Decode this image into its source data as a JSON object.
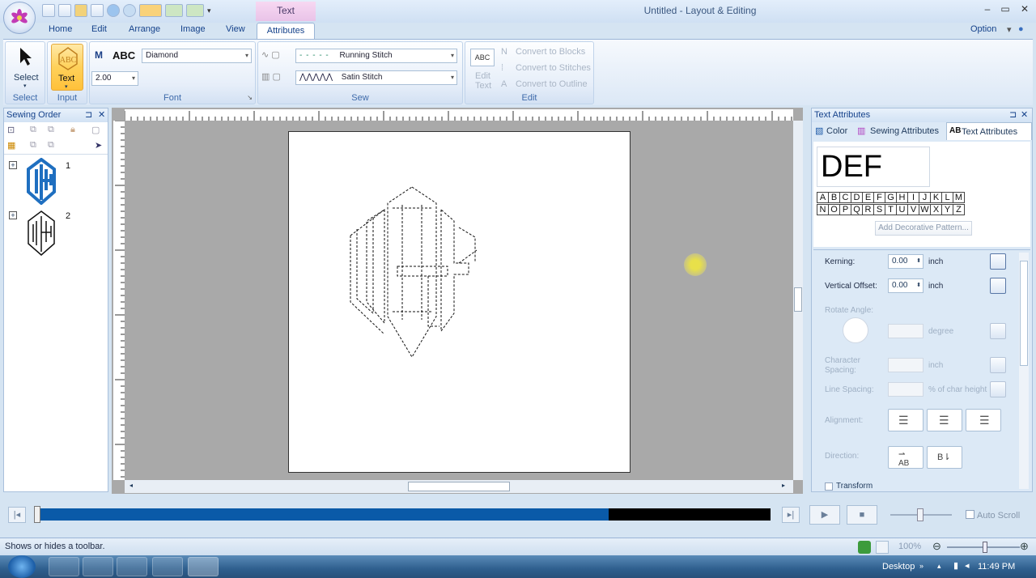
{
  "window": {
    "title": "Untitled - Layout & Editing",
    "context_tab": "Text",
    "option_label": "Option"
  },
  "tabs": [
    "Home",
    "Edit",
    "Arrange",
    "Image",
    "View",
    "Attributes"
  ],
  "ribbon": {
    "select": {
      "button": "Select",
      "group": "Select"
    },
    "input": {
      "button": "Text",
      "group": "Input"
    },
    "font": {
      "sample": "ABC",
      "font_name": "Diamond",
      "size": "2.00",
      "group": "Font"
    },
    "sew": {
      "running": "Running Stitch",
      "satin": "Satin Stitch",
      "group": "Sew"
    },
    "edit": {
      "edit_text_icon": "ABC",
      "edit_text": "Edit",
      "edit_text2": "Text",
      "to_blocks": "Convert to Blocks",
      "to_stitches": "Convert to Stitches",
      "to_outline": "Convert to Outline",
      "group": "Edit"
    }
  },
  "sewing_order": {
    "title": "Sewing Order",
    "items": [
      {
        "num": "1"
      },
      {
        "num": "2"
      }
    ]
  },
  "text_attributes": {
    "title": "Text Attributes",
    "tabs": [
      "Color",
      "Sewing Attributes",
      "Text Attributes"
    ],
    "preview": "DEF",
    "letters_row1": [
      "A",
      "B",
      "C",
      "D",
      "E",
      "F",
      "G",
      "H",
      "I",
      "J",
      "K",
      "L",
      "M"
    ],
    "letters_row2": [
      "N",
      "O",
      "P",
      "Q",
      "R",
      "S",
      "T",
      "U",
      "V",
      "W",
      "X",
      "Y",
      "Z"
    ],
    "add_pattern": "Add Decorative Pattern...",
    "kerning": {
      "label": "Kerning:",
      "value": "0.00",
      "unit": "inch"
    },
    "vertical_offset": {
      "label": "Vertical Offset:",
      "value": "0.00",
      "unit": "inch"
    },
    "rotate_angle": {
      "label": "Rotate Angle:",
      "unit": "degree"
    },
    "char_spacing": {
      "label1": "Character",
      "label2": "Spacing:",
      "unit": "inch"
    },
    "line_spacing": {
      "label": "Line Spacing:",
      "unit": "% of char height"
    },
    "alignment": {
      "label": "Alignment:"
    },
    "direction": {
      "label": "Direction:"
    },
    "transform": {
      "label": "Transform"
    }
  },
  "playback": {
    "auto_scroll": "Auto Scroll",
    "progress": 0.78
  },
  "status": {
    "text": "Shows or hides a toolbar.",
    "zoom": "100%"
  },
  "taskbar": {
    "desktop": "Desktop",
    "time": "11:49 PM"
  },
  "colors": {
    "accent": "#0a5aa8",
    "monogram_blue": "#1f6fc0"
  }
}
